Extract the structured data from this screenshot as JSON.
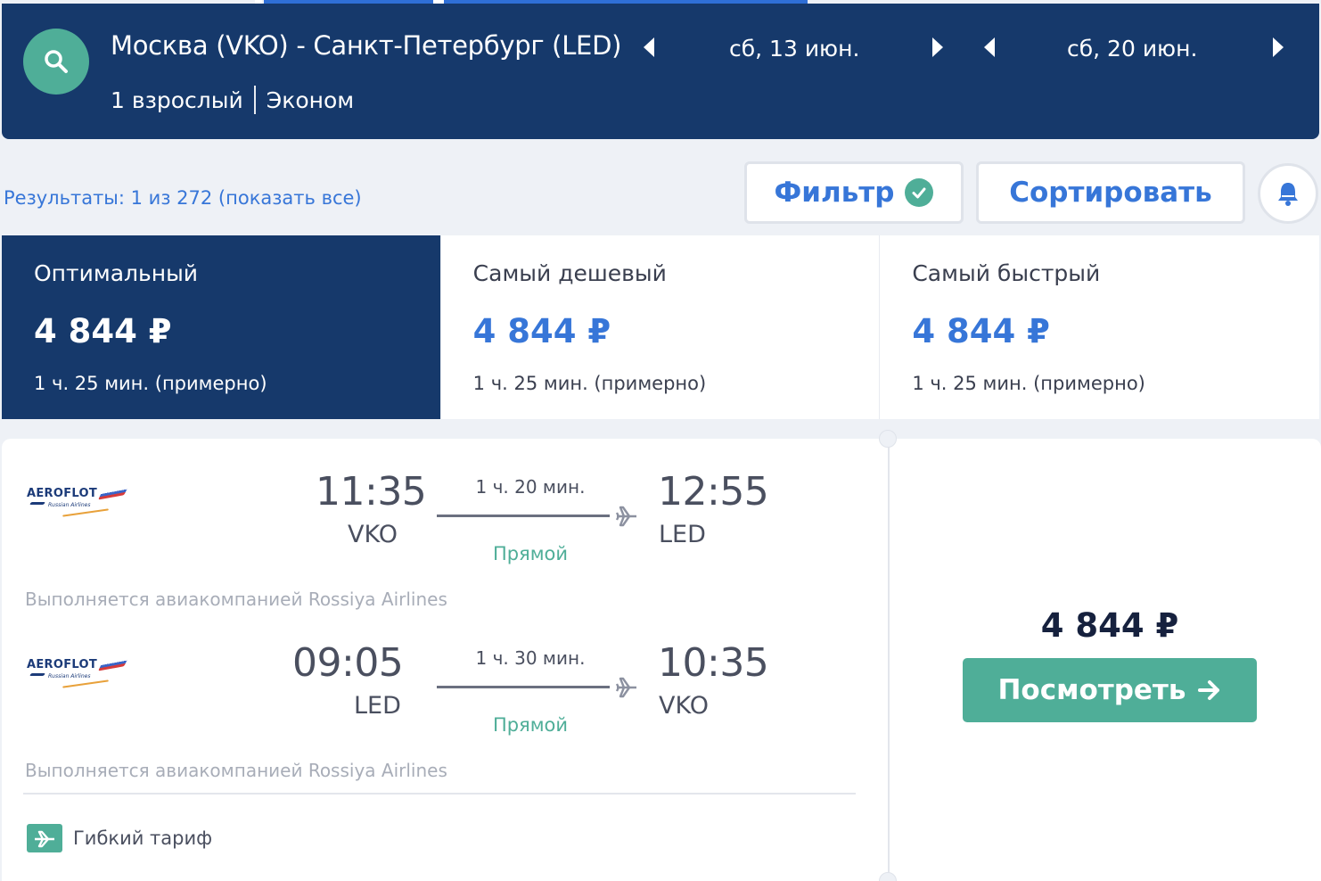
{
  "header": {
    "route": "Москва (VKO) - Санкт-Петербург (LED)",
    "passengers": "1 взрослый",
    "cabin_class": "Эконом",
    "outbound_date": "сб, 13 июн.",
    "return_date": "сб, 20 июн."
  },
  "toolbar": {
    "results_text": "Результаты: 1 из 272 (показать все)",
    "filter_label": "Фильтр",
    "sort_label": "Сортировать"
  },
  "tabs": [
    {
      "title": "Оптимальный",
      "price": "4 844 ₽",
      "duration": "1 ч. 25 мин. (примерно)"
    },
    {
      "title": "Самый дешевый",
      "price": "4 844 ₽",
      "duration": "1 ч. 25 мин. (примерно)"
    },
    {
      "title": "Самый быстрый",
      "price": "4 844 ₽",
      "duration": "1 ч. 25 мин. (примерно)"
    }
  ],
  "result": {
    "segments": [
      {
        "airline_logo_text": "AEROFLOT",
        "airline_logo_sub": "Russian Airlines",
        "dep_time": "11:35",
        "dep_code": "VKO",
        "duration": "1 ч. 20 мин.",
        "stops": "Прямой",
        "arr_time": "12:55",
        "arr_code": "LED",
        "operated_by": "Выполняется авиакомпанией Rossiya Airlines"
      },
      {
        "airline_logo_text": "AEROFLOT",
        "airline_logo_sub": "Russian Airlines",
        "dep_time": "09:05",
        "dep_code": "LED",
        "duration": "1 ч. 30 мин.",
        "stops": "Прямой",
        "arr_time": "10:35",
        "arr_code": "VKO",
        "operated_by": "Выполняется авиакомпанией Rossiya Airlines"
      }
    ],
    "fare_label": "Гибкий тариф",
    "price": "4 844 ₽",
    "view_button": "Посмотреть"
  },
  "icons": {
    "search": "search-icon",
    "prev": "chevron-left-icon",
    "next": "chevron-right-icon",
    "filter_active": "check-circle-icon",
    "bell": "bell-icon",
    "plane": "plane-icon",
    "ticket": "ticket-icon",
    "arrow": "arrow-right-icon"
  },
  "colors": {
    "header_bg": "#16396b",
    "accent_blue": "#3776d8",
    "accent_green": "#4fae98",
    "page_bg": "#eef1f6"
  }
}
